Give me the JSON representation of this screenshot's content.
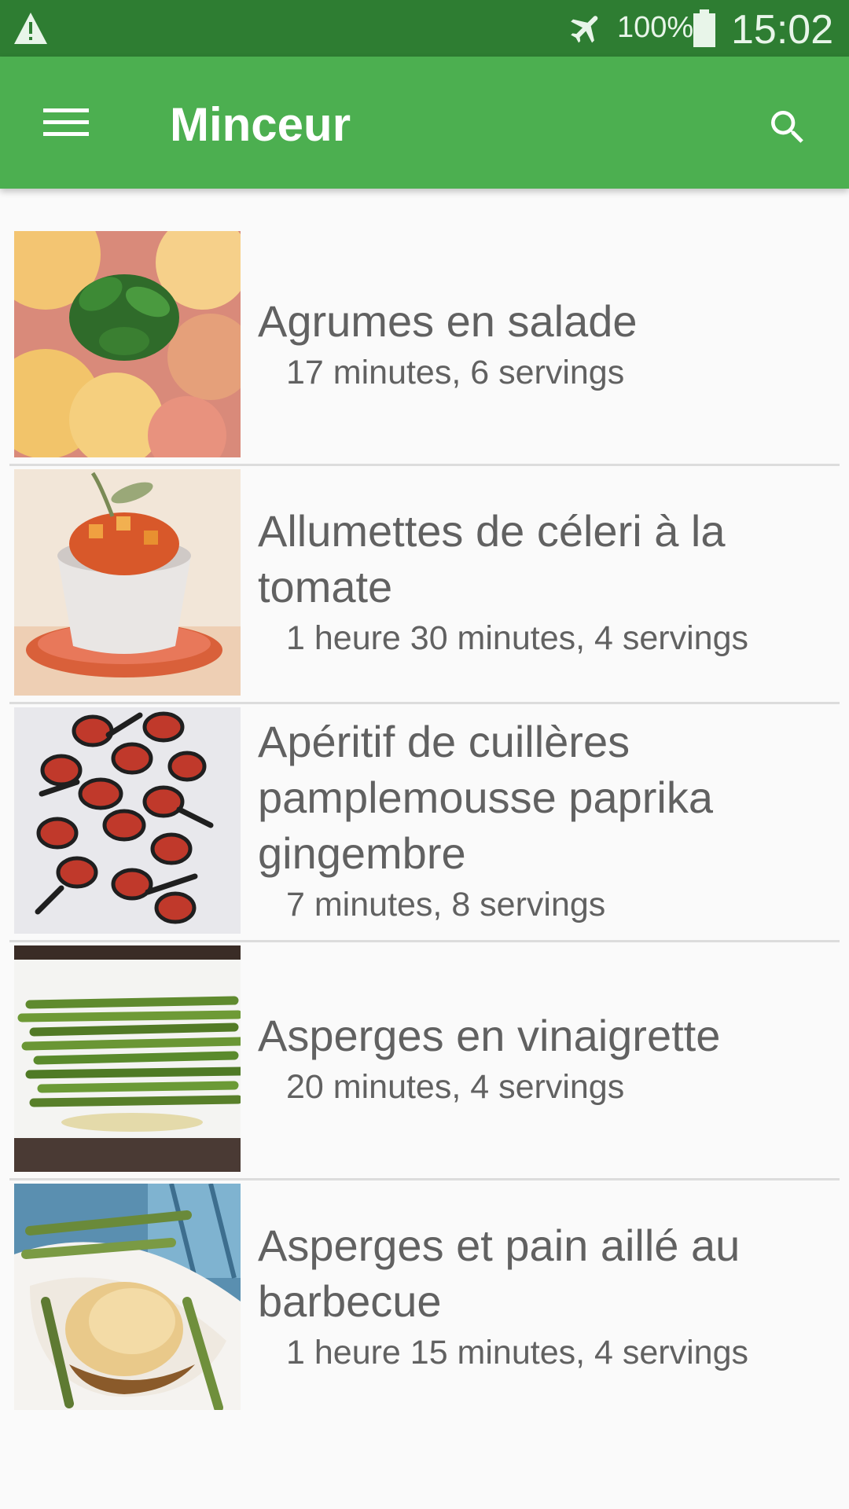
{
  "status_bar": {
    "battery_percent": "100%",
    "time": "15:02",
    "icons": [
      "warning-icon",
      "airplane-mode-icon",
      "battery-icon"
    ]
  },
  "app_bar": {
    "title": "Minceur",
    "icons": [
      "menu-icon",
      "search-icon"
    ],
    "color": "#4caf50"
  },
  "recipes": [
    {
      "name": "Agrumes en salade",
      "meta": "17 minutes, 6 servings",
      "image": "citrus-salad-photo"
    },
    {
      "name": "Allumettes de céleri à la tomate",
      "meta": "1 heure 30 minutes, 4 servings",
      "image": "celery-tomato-photo"
    },
    {
      "name": "Apéritif de cuillères pamplemousse paprika gingembre",
      "meta": "7 minutes, 8 servings",
      "image": "grapefruit-spoons-photo"
    },
    {
      "name": "Asperges en vinaigrette",
      "meta": "20 minutes, 4 servings",
      "image": "asparagus-vinaigrette-photo"
    },
    {
      "name": "Asperges et pain aillé au barbecue",
      "meta": "1 heure 15 minutes, 4 servings",
      "image": "asparagus-garlic-bread-photo"
    }
  ]
}
